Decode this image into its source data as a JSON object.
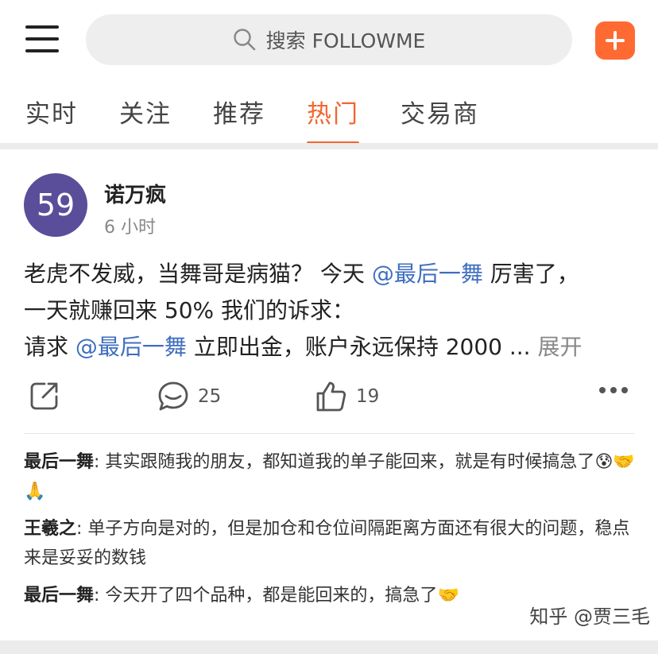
{
  "header": {
    "search_placeholder": "搜索 FOLLOWME"
  },
  "tabs": [
    {
      "label": "实时"
    },
    {
      "label": "关注"
    },
    {
      "label": "推荐"
    },
    {
      "label": "热门"
    },
    {
      "label": "交易商"
    }
  ],
  "active_tab": "热门",
  "post": {
    "avatar_text": "59",
    "author": "诺万疯",
    "time": "6 小时",
    "line1_a": "老虎不发威，当舞哥是病猫？ 今天 ",
    "mention": "@最后一舞",
    "line1_b": " 厉害了，",
    "line2": "一天就赚回来 50% 我们的诉求：",
    "line3_a": "请求 ",
    "line3_b": " 立即出金，账户永远保持 2000 ... ",
    "expand": "展开",
    "share_count": "",
    "comment_count": "25",
    "like_count": "19"
  },
  "comments": [
    {
      "user": "最后一舞",
      "text": ": 其实跟随我的朋友，都知道我的单子能回来，就是有时候搞急了",
      "emojis": "😰🤝🙏"
    },
    {
      "user": "王羲之",
      "text": ": 单子方向是对的，但是加仓和仓位间隔距离方面还有很大的问题，稳点来是妥妥的数钱",
      "emojis": ""
    },
    {
      "user": "最后一舞",
      "text": ": 今天开了四个品种，都是能回来的，搞急了",
      "emojis": "🤝"
    }
  ],
  "watermark": "知乎 @贾三毛",
  "colors": {
    "accent": "#f2662f",
    "add_button": "#ff6a32",
    "avatar": "#5a4e9a",
    "mention": "#3f6fbf"
  }
}
